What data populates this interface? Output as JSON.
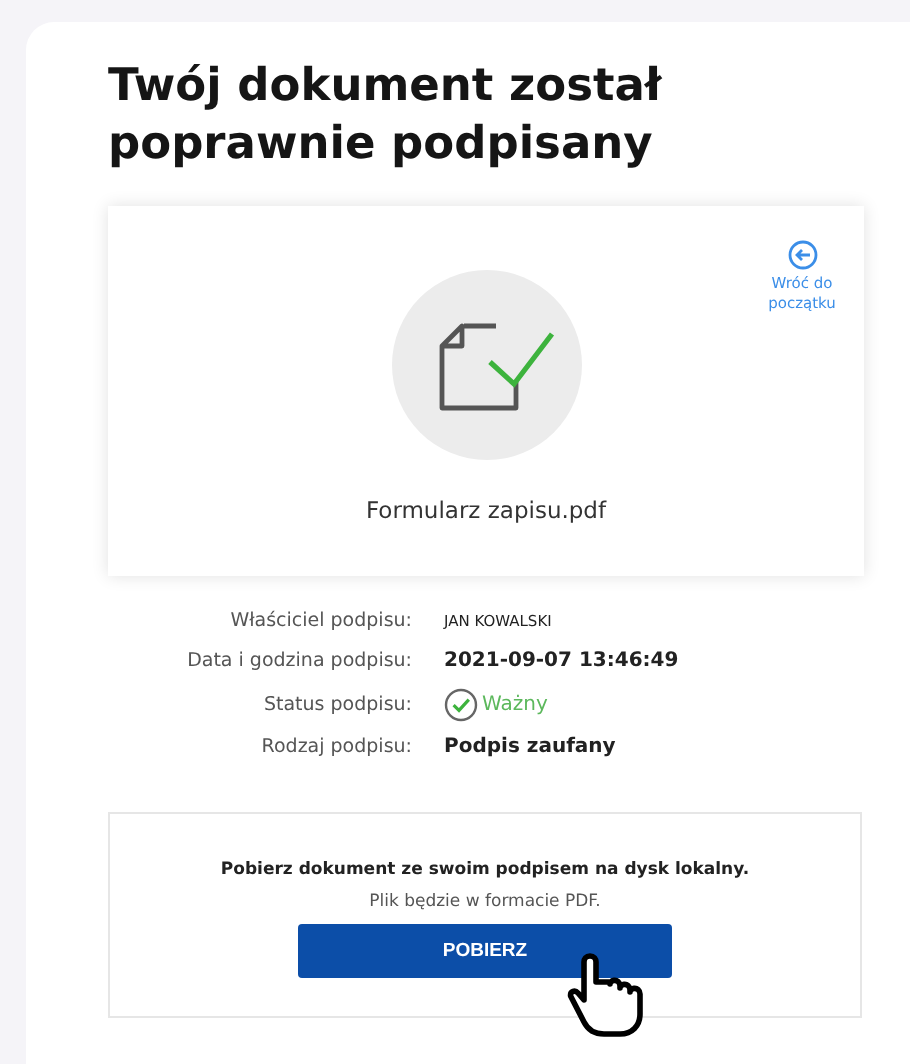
{
  "title": "Twój dokument został poprawnie podpisany",
  "document": {
    "file_name": "Formularz zapisu.pdf",
    "back_link": "Wróć do początku"
  },
  "details": [
    {
      "label": "Właściciel podpisu:",
      "value": "JAN KOWALSKI",
      "kind": "caps"
    },
    {
      "label": "Data i godzina podpisu:",
      "value": "2021-09-07 13:46:49",
      "kind": "bold"
    },
    {
      "label": "Status podpisu:",
      "value": "Ważny",
      "kind": "status"
    },
    {
      "label": "Rodzaj podpisu:",
      "value": "Podpis zaufany",
      "kind": "bold"
    }
  ],
  "download": {
    "heading": "Pobierz dokument ze swoim podpisem na dysk lokalny.",
    "note": "Plik będzie w formacie PDF.",
    "button": "POBIERZ"
  }
}
